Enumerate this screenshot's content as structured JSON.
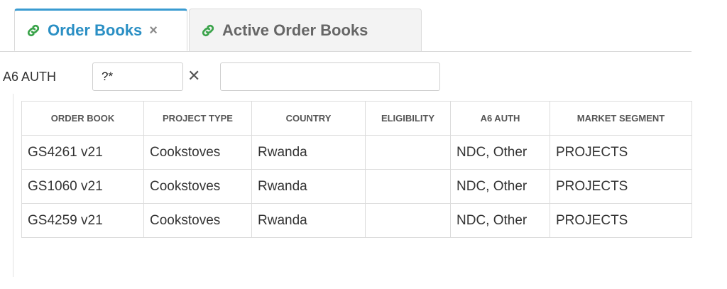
{
  "tabs": [
    {
      "label": "Order Books",
      "close": "×",
      "active": true
    },
    {
      "label": "Active Order Books",
      "active": false
    }
  ],
  "filter": {
    "label": "A6 AUTH",
    "value": "?*",
    "clear": "✕",
    "second_value": ""
  },
  "table": {
    "columns": [
      "ORDER BOOK",
      "PROJECT TYPE",
      "COUNTRY",
      "ELIGIBILITY",
      "A6 AUTH",
      "MARKET SEGMENT"
    ],
    "rows": [
      [
        "GS4261 v21",
        "Cookstoves",
        "Rwanda",
        "",
        "NDC, Other",
        "PROJECTS"
      ],
      [
        "GS1060 v21",
        "Cookstoves",
        "Rwanda",
        "",
        "NDC, Other",
        "PROJECTS"
      ],
      [
        "GS4259 v21",
        "Cookstoves",
        "Rwanda",
        "",
        "NDC, Other",
        "PROJECTS"
      ]
    ]
  },
  "colors": {
    "accent": "#2a8fc4",
    "link_icon_green": "#3aa34a"
  }
}
